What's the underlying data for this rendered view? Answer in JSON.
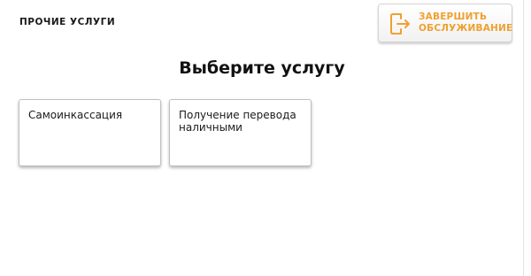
{
  "header": {
    "section_title": "ПРОЧИЕ УСЛУГИ",
    "end_button": {
      "line1": "ЗАВЕРШИТЬ",
      "line2": "ОБСЛУЖИВАНИЕ",
      "icon": "exit-door-icon",
      "color": "#f0a030"
    }
  },
  "main": {
    "heading": "Выберите услугу",
    "services": [
      {
        "line1": "Самоинкассация",
        "line2": ""
      },
      {
        "line1": "Получение перевода",
        "line2": "наличными"
      }
    ]
  }
}
